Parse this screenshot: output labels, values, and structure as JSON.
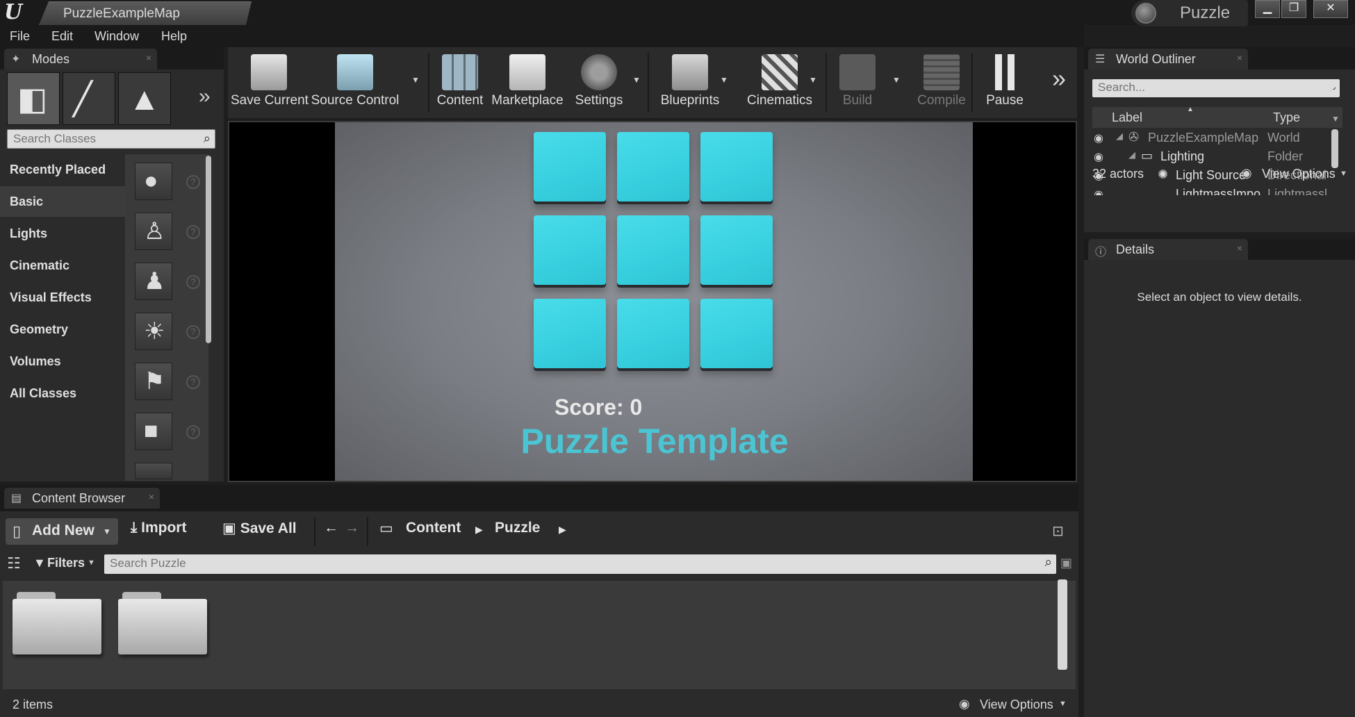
{
  "titlebar": {
    "map_tab": "PuzzleExampleMap",
    "project_name": "Puzzle",
    "minimize": "▁",
    "maximize": "❐",
    "close": "✕"
  },
  "menu": [
    "File",
    "Edit",
    "Window",
    "Help"
  ],
  "modes": {
    "tab_label": "Modes",
    "search_placeholder": "Search Classes",
    "categories": [
      "Recently Placed",
      "Basic",
      "Lights",
      "Cinematic",
      "Visual Effects",
      "Geometry",
      "Volumes",
      "All Classes"
    ],
    "selected_category": "Basic"
  },
  "toolbar": {
    "buttons": [
      "Save Current",
      "Source Control",
      "Content",
      "Marketplace",
      "Settings",
      "Blueprints",
      "Cinematics",
      "Build",
      "Compile",
      "Pause"
    ]
  },
  "viewport": {
    "score_text": "Score: 0",
    "title_text": "Puzzle Template",
    "tile_color": "#3dd0df"
  },
  "outliner": {
    "tab_label": "World Outliner",
    "search_placeholder": "Search...",
    "col_label": "Label",
    "col_type": "Type",
    "rows": [
      {
        "label": "PuzzleExampleMap",
        "type": "World"
      },
      {
        "label": "Lighting",
        "type": "Folder"
      },
      {
        "label": "Light Source",
        "type": "Directional"
      },
      {
        "label": "LightmassImpo",
        "type": "Lightmassl"
      }
    ],
    "actor_count": "32 actors",
    "view_options": "View Options"
  },
  "details": {
    "tab_label": "Details",
    "empty_text": "Select an object to view details."
  },
  "content_browser": {
    "tab_label": "Content Browser",
    "add_new": "Add New",
    "import": "Import",
    "save_all": "Save All",
    "path": [
      "Content",
      "Puzzle"
    ],
    "filters": "Filters",
    "search_placeholder": "Search Puzzle",
    "item_count": "2 items",
    "view_options": "View Options"
  }
}
